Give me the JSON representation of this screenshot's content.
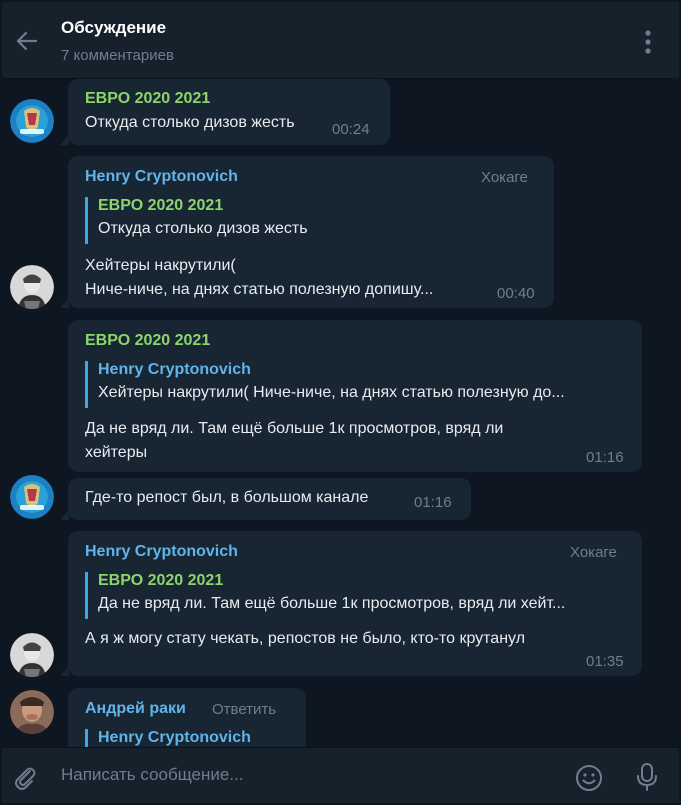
{
  "header": {
    "title": "Обсуждение",
    "subtitle": "7 комментариев"
  },
  "messages": [
    {
      "author": "ЕВРО 2020 2021",
      "text": "Откуда столько дизов жесть",
      "time": "00:24"
    },
    {
      "author": "Henry Cryptonovich",
      "badge": "Хокаге",
      "quote_author": "ЕВРО 2020 2021",
      "quote_text": "Откуда столько дизов жесть",
      "text_line1": "Хейтеры накрутили(",
      "text_line2": "Ниче-ниче, на днях статью полезную допишу...",
      "time": "00:40"
    },
    {
      "author": "ЕВРО 2020 2021",
      "quote_author": "Henry Cryptonovich",
      "quote_text": "Хейтеры накрутили( Ниче-ниче, на днях статью полезную до...",
      "text_line1": "Да не вряд ли. Там ещё больше 1к просмотров, вряд ли",
      "text_line2": "хейтеры",
      "time": "01:16"
    },
    {
      "text": "Где-то репост был, в большом канале",
      "time": "01:16"
    },
    {
      "author": "Henry Cryptonovich",
      "badge": "Хокаге",
      "quote_author": "ЕВРО 2020 2021",
      "quote_text": "Да не вряд ли. Там ещё больше 1к просмотров, вряд ли хейт...",
      "text": "А я ж могу стату чекать, репостов не было, кто-то крутанул",
      "time": "01:35"
    },
    {
      "author": "Андрей раки",
      "reply_label": "Ответить",
      "quote_author": "Henry Cryptonovich"
    }
  ],
  "composer": {
    "placeholder": "Написать сообщение..."
  },
  "colors": {
    "background": "#0e1621",
    "header": "#17212b",
    "bubble": "#182533",
    "name_green": "#8bd56b",
    "name_blue": "#61b4ea",
    "secondary_text": "#6d7f8f"
  },
  "icons": [
    "back-arrow-icon",
    "more-vertical-icon",
    "paperclip-icon",
    "emoji-icon",
    "microphone-icon"
  ]
}
